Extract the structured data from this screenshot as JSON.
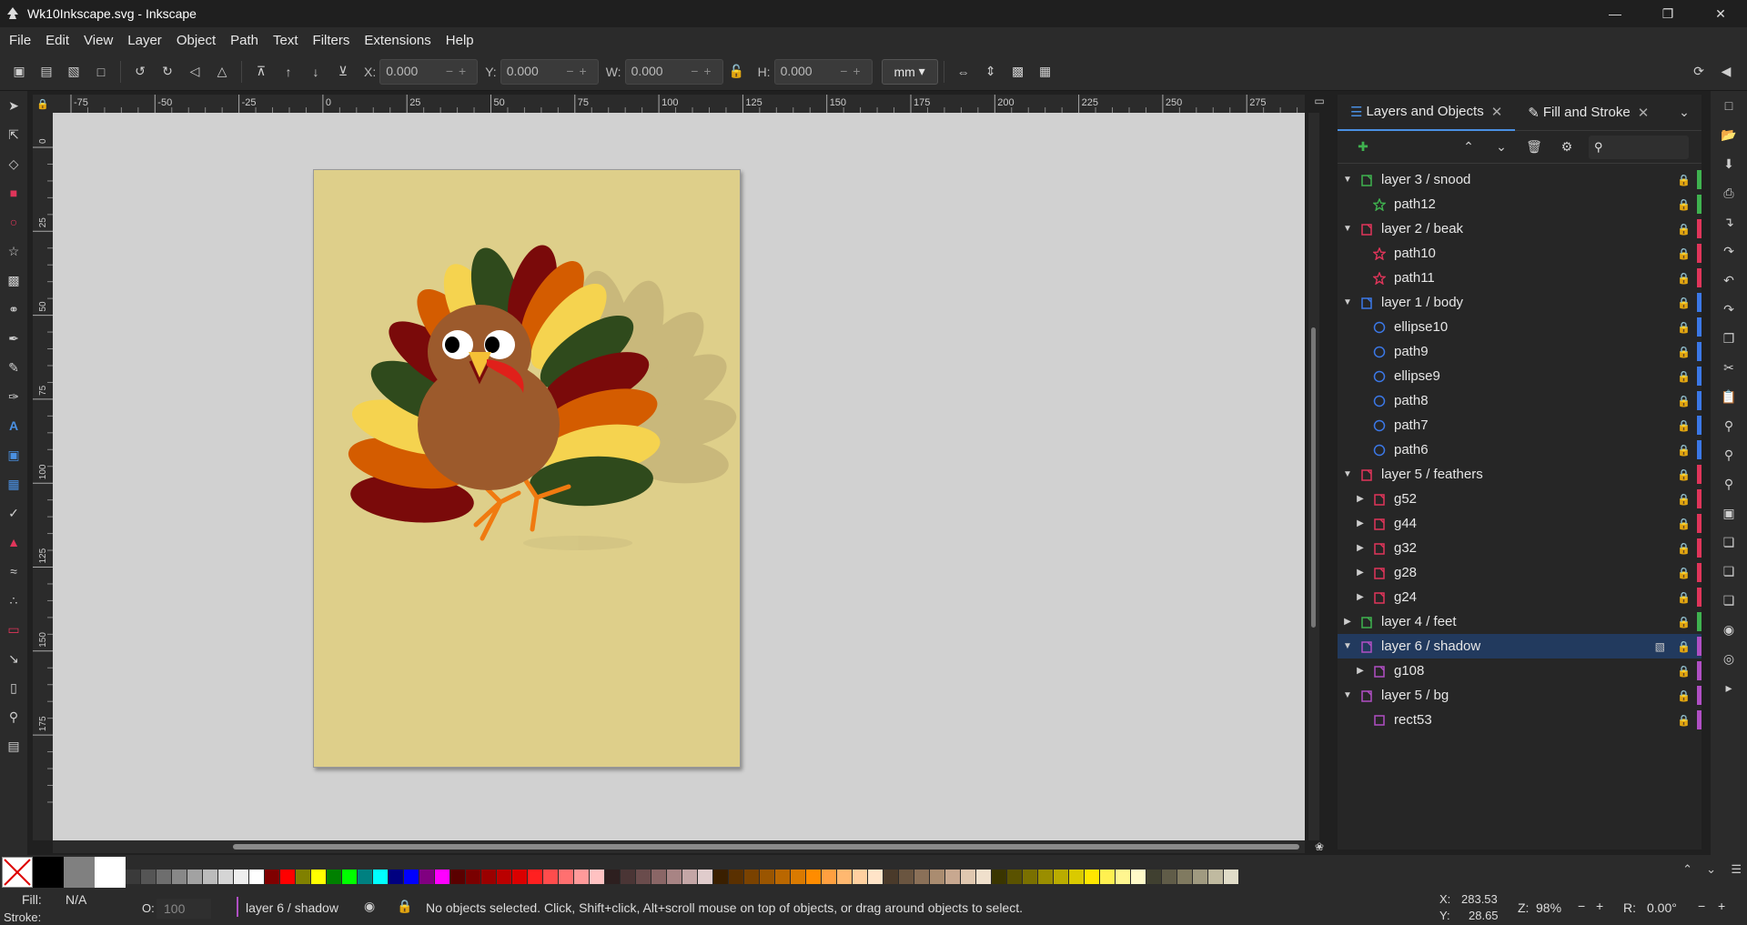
{
  "window": {
    "title": "Wk10Inkscape.svg - Inkscape"
  },
  "menu": [
    "File",
    "Edit",
    "View",
    "Layer",
    "Object",
    "Path",
    "Text",
    "Filters",
    "Extensions",
    "Help"
  ],
  "toolbar": {
    "x_label": "X:",
    "x_value": "0.000",
    "y_label": "Y:",
    "y_value": "0.000",
    "w_label": "W:",
    "w_value": "0.000",
    "h_label": "H:",
    "h_value": "0.000",
    "unit": "mm"
  },
  "ruler": {
    "h_ticks": [
      "-75",
      "-50",
      "-25",
      "0",
      "25",
      "50",
      "75",
      "100",
      "125",
      "150",
      "175",
      "200",
      "225",
      "250",
      "275"
    ],
    "v_ticks": [
      "0",
      "25",
      "50",
      "75",
      "100",
      "125",
      "150",
      "175"
    ]
  },
  "panel": {
    "tab_layers": "Layers and Objects",
    "tab_fill": "Fill and Stroke",
    "rows": [
      {
        "label": "layer 3 / snood",
        "type": "layer",
        "color": "#3fb24f"
      },
      {
        "label": "path12",
        "type": "star",
        "color": "#3fb24f"
      },
      {
        "label": "layer 2 / beak",
        "type": "layer",
        "color": "#e0355a"
      },
      {
        "label": "path10",
        "type": "star",
        "color": "#e0355a"
      },
      {
        "label": "path11",
        "type": "star",
        "color": "#e0355a"
      },
      {
        "label": "layer 1 /  body",
        "type": "layer",
        "color": "#3b78e7"
      },
      {
        "label": "ellipse10",
        "type": "circle",
        "color": "#3b78e7"
      },
      {
        "label": "path9",
        "type": "circle",
        "color": "#3b78e7"
      },
      {
        "label": "ellipse9",
        "type": "circle",
        "color": "#3b78e7"
      },
      {
        "label": "path8",
        "type": "circle",
        "color": "#3b78e7"
      },
      {
        "label": "path7",
        "type": "circle",
        "color": "#3b78e7"
      },
      {
        "label": "path6",
        "type": "circle",
        "color": "#3b78e7"
      },
      {
        "label": "layer 5 / feathers",
        "type": "layer",
        "color": "#e0355a"
      },
      {
        "label": "g52",
        "type": "group",
        "color": "#e0355a"
      },
      {
        "label": "g44",
        "type": "group",
        "color": "#e0355a"
      },
      {
        "label": "g32",
        "type": "group",
        "color": "#e0355a"
      },
      {
        "label": "g28",
        "type": "group",
        "color": "#e0355a"
      },
      {
        "label": "g24",
        "type": "group",
        "color": "#e0355a"
      },
      {
        "label": "layer 4 / feet",
        "type": "layer",
        "color": "#3fb24f"
      },
      {
        "label": "layer 6 / shadow",
        "type": "layer",
        "color": "#b04fc4"
      },
      {
        "label": "g108",
        "type": "group",
        "color": "#b04fc4"
      },
      {
        "label": "layer 5 / bg",
        "type": "layer",
        "color": "#b04fc4"
      },
      {
        "label": "rect53",
        "type": "rect",
        "color": "#b04fc4"
      }
    ]
  },
  "status": {
    "fill_label": "Fill:",
    "fill_value": "N/A",
    "stroke_label": "Stroke:",
    "opacity_label": "O:",
    "opacity_value": "100",
    "layer": "layer 6 / shadow",
    "message": "No objects selected. Click, Shift+click, Alt+scroll mouse on top of objects, or drag around objects to select.",
    "x_label": "X:",
    "x_value": "283.53",
    "y_label": "Y:",
    "y_value": "28.65",
    "z_label": "Z:",
    "zoom": "98%",
    "r_label": "R:",
    "rotation": "0.00°"
  }
}
